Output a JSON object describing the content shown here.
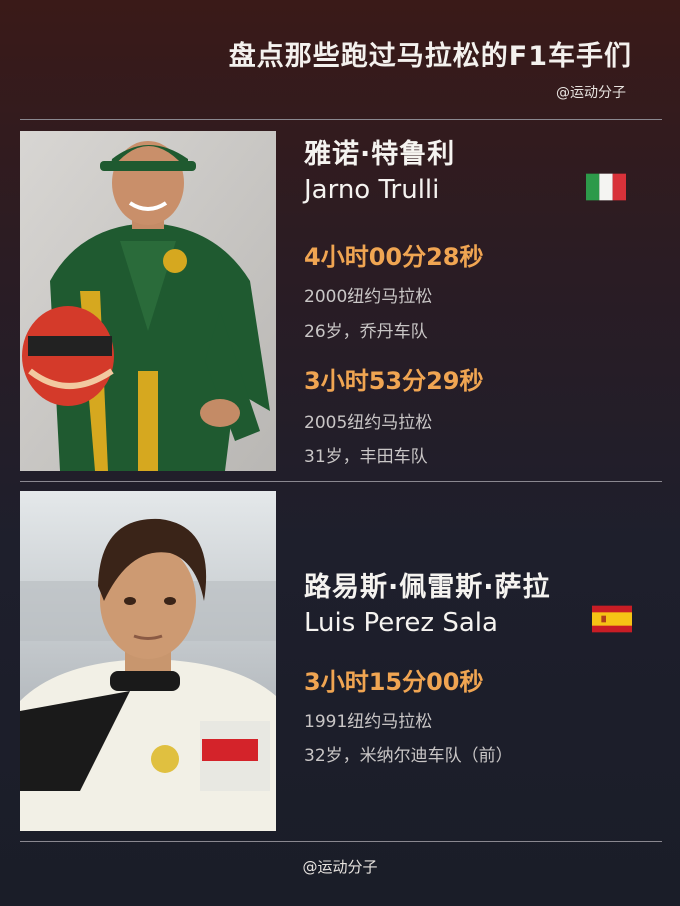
{
  "header": {
    "title": "盘点那些跑过马拉松的F1车手们",
    "handle": "@运动分子"
  },
  "drivers": [
    {
      "name_cn": "雅诺·特鲁利",
      "name_en": "Jarno Trulli",
      "flag_icon": "italy-flag-icon",
      "records": [
        {
          "time": "4小时00分28秒",
          "race": "2000纽约马拉松",
          "detail": "26岁，乔丹车队"
        },
        {
          "time": "3小时53分29秒",
          "race": "2005纽约马拉松",
          "detail": "31岁，丰田车队"
        }
      ]
    },
    {
      "name_cn": "路易斯·佩雷斯·萨拉",
      "name_en": "Luis Perez Sala",
      "flag_icon": "spain-flag-icon",
      "records": [
        {
          "time": "3小时15分00秒",
          "race": "1991纽约马拉松",
          "detail": "32岁，米纳尔迪车队（前）"
        }
      ]
    }
  ],
  "footer": {
    "handle": "@运动分子"
  },
  "colors": {
    "accent": "#f0a552",
    "text": "#f5f3f0",
    "subtext": "#c9c6c6"
  }
}
